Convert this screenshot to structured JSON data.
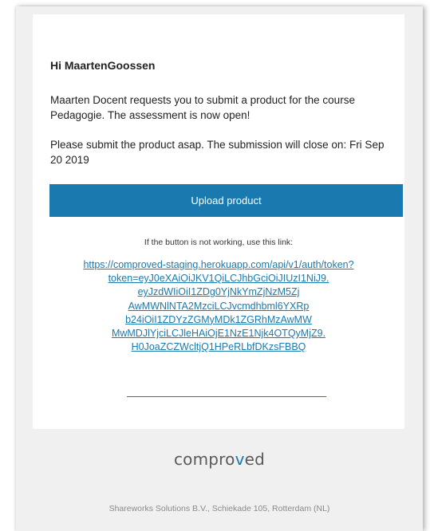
{
  "email": {
    "greeting": "Hi MaartenGoossen",
    "paragraph1": "Maarten Docent requests you to submit a product for the course Pedagogie. The assessment is now open!",
    "paragraph2": "Please submit the product asap. The submission will close on: Fri Sep 20 2019",
    "button_label": "Upload product",
    "fallback_hint": "If the button is not working, use this link:",
    "link_lines": [
      "https://comproved-staging.herokuapp.com/api/v1/auth/token?",
      "token=eyJ0eXAiOiJKV1QiLCJhbGciOiJIUzI1NiJ9.",
      "eyJzdWIiOiI1ZDg0YjNkYmZjNzM5Zj",
      "AwMWNlNTA2MzciLCJvcmdhbml6YXRp",
      "b24iOiI1ZDYzZGMyMDk1ZGRhMzAwMW",
      "MwMDJlYjciLCJleHAiOjE1NzE1Njk4OTQyMjZ9.",
      "H0JoaZCZWcltjQ1HPeRLbfDKzsFBBQ"
    ]
  },
  "footer": {
    "logo_prefix": "compro",
    "logo_accent": "v",
    "logo_suffix": "ed",
    "address": "Shareworks Solutions B.V., Schiekade 105, Rotterdam (NL)"
  },
  "colors": {
    "accent": "#1a7ab0",
    "background": "#f0f0f0",
    "card": "#ffffff",
    "text": "#222222"
  }
}
